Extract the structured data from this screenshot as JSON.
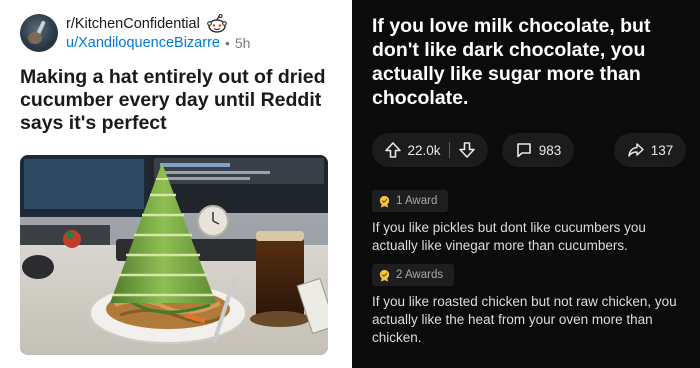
{
  "left_post": {
    "subreddit": "r/KitchenConfidential",
    "username": "u/XandiloquenceBizarre",
    "separator": "•",
    "age": "5h",
    "title": "Making a hat entirely out of dried cucumber every day until Reddit says it's perfect",
    "image_icon": "photo-of-cucumber-hat-on-noodles"
  },
  "right_post": {
    "title": "If you love milk chocolate, but don't like dark chocolate, you actually like sugar more than chocolate.",
    "upvotes": "22.0k",
    "comments": "983",
    "shares": "137",
    "replies": [
      {
        "award": "1 Award",
        "text": "If you like pickles but dont like cucumbers you actually like vinegar more than cucumbers."
      },
      {
        "award": "2 Awards",
        "text": "If you like roasted chicken but not raw chicken, you actually like the heat from your oven more than chicken."
      }
    ]
  },
  "colors": {
    "link_blue": "#0079d3",
    "dark_bg": "#0b0b0b",
    "pill_bg": "#1c1c1e",
    "award_gold": "#f5c542"
  }
}
